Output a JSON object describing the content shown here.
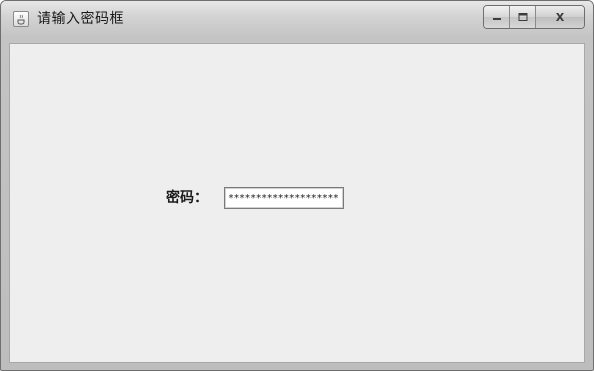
{
  "window": {
    "title": "请输入密码框",
    "app_icon": "java-cup-icon",
    "controls": {
      "minimize_icon": "minimize-icon",
      "maximize_icon": "maximize-icon",
      "close_label": "X"
    }
  },
  "form": {
    "password_label": "密码：",
    "password_value": "********************"
  },
  "colors": {
    "client_background": "#eeeeee",
    "titlebar": "#d3d3d3"
  }
}
